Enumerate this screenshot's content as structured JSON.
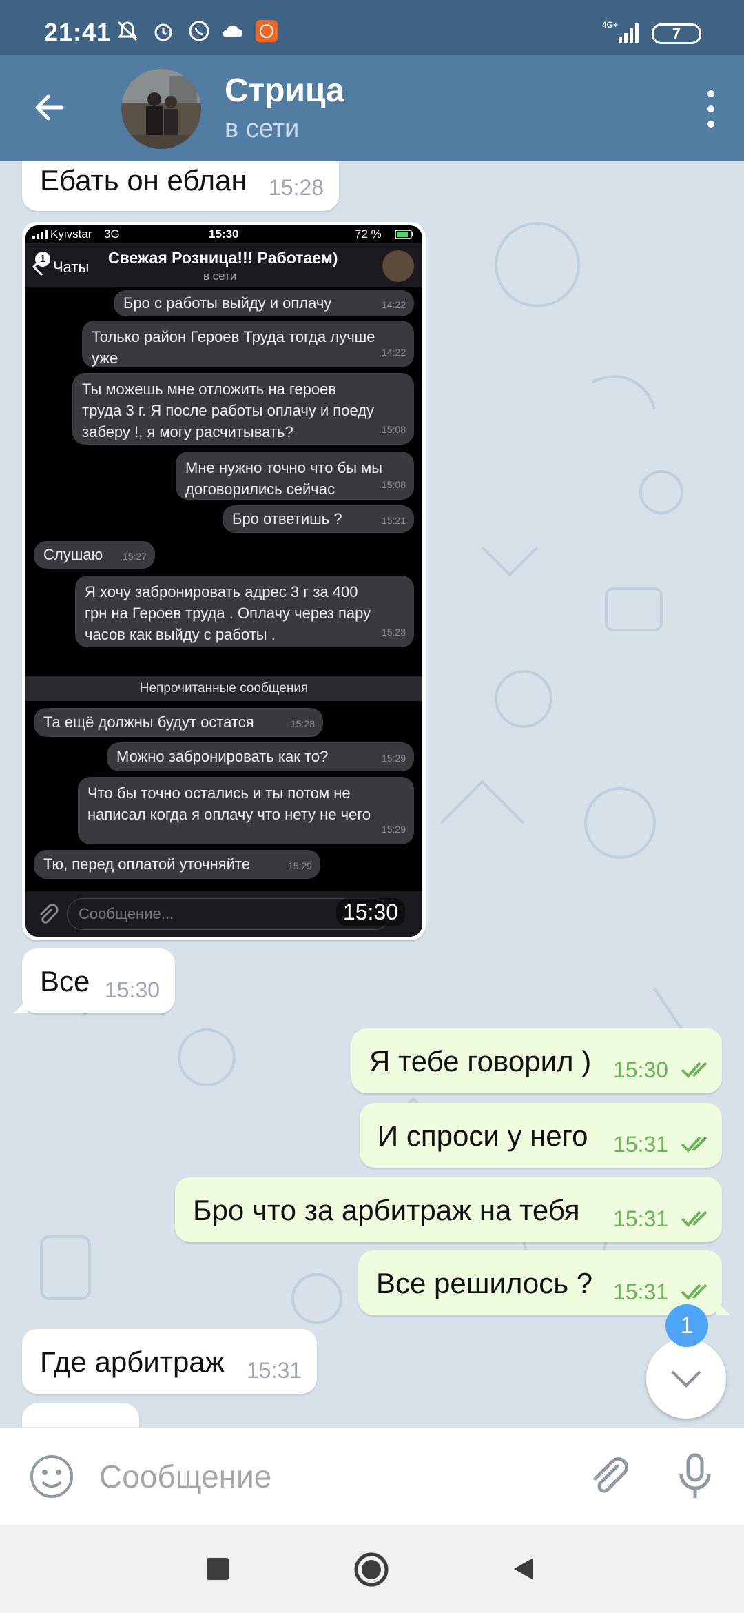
{
  "status_bar": {
    "time": "21:41",
    "network": "4G+",
    "battery": "7"
  },
  "header": {
    "contact_name": "Стрица",
    "contact_status": "в сети"
  },
  "messages": [
    {
      "direction": "in",
      "text": "Ебать он еблан",
      "time": "15:28"
    },
    {
      "direction": "in",
      "type": "photo",
      "time": "15:30"
    },
    {
      "direction": "in",
      "text": "Все",
      "time": "15:30"
    },
    {
      "direction": "out",
      "text": "Я тебе говорил )",
      "time": "15:30"
    },
    {
      "direction": "out",
      "text": "И спроси у него",
      "time": "15:31"
    },
    {
      "direction": "out",
      "text": "Бро что за арбитраж на тебя",
      "time": "15:31"
    },
    {
      "direction": "out",
      "text": "Все решилось ?",
      "time": "15:31"
    },
    {
      "direction": "in",
      "text": "Где арбитраж",
      "time": "15:31"
    }
  ],
  "embedded_screenshot": {
    "carrier": "Kyivstar",
    "net": "3G",
    "time": "15:30",
    "battery": "72 %",
    "back_label": "Чаты",
    "back_badge": "1",
    "title": "Свежая Розница!!! Работаем)",
    "status": "в сети",
    "bubbles": [
      {
        "line1": "Бро с работы выйду и оплачу",
        "time": "14:22"
      },
      {
        "line1": "Только район Героев Труда тогда лучше",
        "line2": "уже",
        "time": "14:22"
      },
      {
        "line1": "Ты можешь мне отложить на героев",
        "line2": "труда 3 г. Я после работы оплачу и поеду",
        "line3": "заберу !, я могу расчитывать?",
        "time": "15:08"
      },
      {
        "line1": "Мне нужно точно что бы мы",
        "line2": "договорились сейчас",
        "time": "15:08"
      },
      {
        "line1": "Бро ответишь ?",
        "time": "15:21"
      },
      {
        "line1": "Слушаю",
        "time": "15:27"
      },
      {
        "line1": "Я хочу забронировать адрес 3 г за 400",
        "line2": "грн на Героев труда . Оплачу через пару",
        "line3": "часов как выйду с работы .",
        "time": "15:28"
      },
      {
        "line1": "Та ещё должны будут остатся",
        "time": "15:28"
      },
      {
        "line1": "Можно забронировать как то?",
        "time": "15:29"
      },
      {
        "line1": "Что бы точно остались и ты потом не",
        "line2": "написал когда я оплачу что нету не чего",
        "time": "15:29"
      },
      {
        "line1": "Тю, перед оплатой уточняйте",
        "time": "15:29"
      }
    ],
    "unread_label": "Непрочитанные сообщения",
    "input_placeholder": "Сообщение..."
  },
  "scroll_down": {
    "unread_count": "1"
  },
  "composer": {
    "placeholder": "Сообщение"
  },
  "colors": {
    "header": "#517da2",
    "status_bar": "#3f6385",
    "chat_bg": "#d6e1ea",
    "incoming": "#ffffff",
    "outgoing": "#effdde",
    "out_time": "#6cb35b",
    "badge": "#4ea4f6"
  },
  "icons": [
    "back-arrow-icon",
    "more-vert-icon",
    "double-check-icon",
    "smile-icon",
    "attach-icon",
    "mic-icon",
    "chevron-down-icon",
    "nav-square-icon",
    "nav-circle-icon",
    "nav-triangle-icon"
  ]
}
